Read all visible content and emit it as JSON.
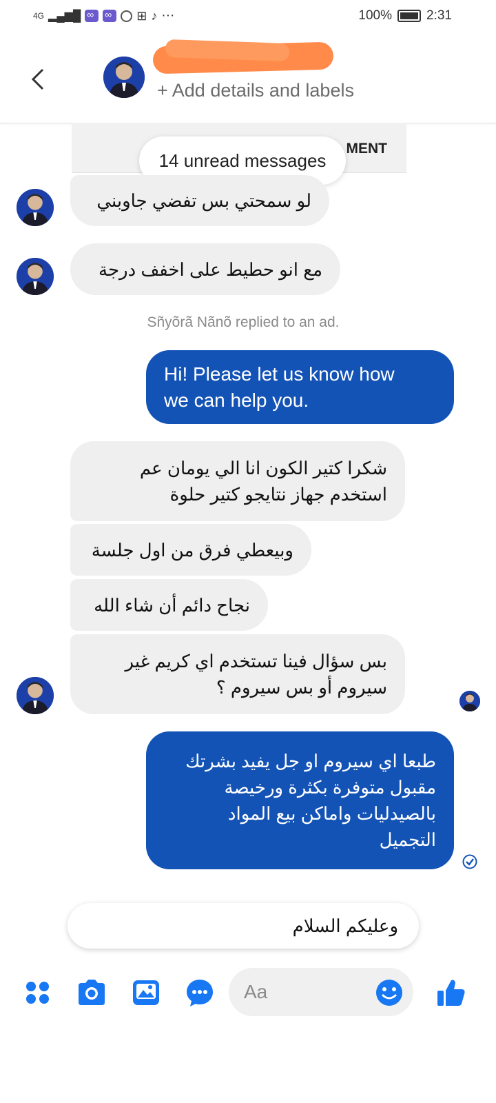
{
  "status_bar": {
    "network": "4G",
    "battery": "100%",
    "time": "2:31",
    "more": "···"
  },
  "header": {
    "back_icon": "chevron-left-icon",
    "subtitle": "+ Add details and labels"
  },
  "conversation": {
    "partial_card_text": "MENT",
    "unread_pill": "14 unread messages",
    "system_note": "Sñyõrã Nãnõ replied to an ad.",
    "messages": [
      {
        "dir": "in",
        "lines": [
          "لو سمحتي بس تفضي جاوبني"
        ]
      },
      {
        "dir": "in",
        "lines": [
          "مع انو حطيط على اخفف درجة"
        ]
      },
      {
        "dir": "out",
        "lines": [
          "Hi! Please let us know how",
          "we can help you."
        ]
      },
      {
        "dir": "in",
        "lines": [
          "شكرا كتير الكون انا الي يومان عم",
          "استخدم جهاز نتايجو كتير حلوة"
        ]
      },
      {
        "dir": "in",
        "lines": [
          "وبيعطي فرق من اول جلسة"
        ]
      },
      {
        "dir": "in",
        "lines": [
          "نجاح دائم أن شاء الله"
        ]
      },
      {
        "dir": "in",
        "lines": [
          "بس سؤال فينا تستخدم اي كريم غير",
          "سيروم أو بس سيروم ؟"
        ]
      },
      {
        "dir": "out",
        "lines": [
          "طبعا اي سيروم او جل يفيد بشرتك",
          "مقبول متوفرة بكثرة ورخيصة",
          "بالصيدليات واماكن بيع المواد",
          "التجميل"
        ]
      }
    ]
  },
  "composer": {
    "quick_reply": "وعليكم السلام",
    "placeholder": "Aa",
    "accent_color": "#1877f2",
    "icons": [
      "grid-icon",
      "camera-icon",
      "gallery-icon",
      "chat-icon",
      "emoji-icon",
      "like-icon"
    ]
  }
}
